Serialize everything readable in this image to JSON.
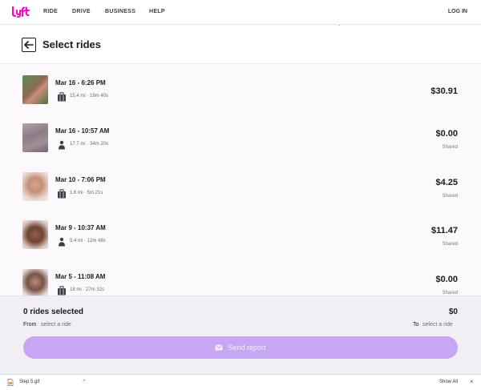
{
  "nav": {
    "logo_icon": "lyft-logo-icon",
    "links": [
      "RIDE",
      "DRIVE",
      "BUSINESS",
      "HELP"
    ],
    "login": "LOG IN"
  },
  "header": {
    "back_icon": "arrow-left-icon",
    "title": "Select rides"
  },
  "rides": [
    {
      "time": "Mar 16 - 6:26 PM",
      "meta": "15.4 mi · 19m 40s",
      "price": "$30.91",
      "note": "",
      "type_icon": "luggage-icon"
    },
    {
      "time": "Mar 16 - 10:57 AM",
      "meta": "17.7 mi · 34m 20s",
      "price": "$0.00",
      "note": "Shared",
      "type_icon": "person-icon"
    },
    {
      "time": "Mar 10 - 7:06 PM",
      "meta": "1.6 mi · 5m 21s",
      "price": "$4.25",
      "note": "Shared",
      "type_icon": "luggage-icon"
    },
    {
      "time": "Mar 9 - 10:37 AM",
      "meta": "5.4 mi · 12m 48s",
      "price": "$11.47",
      "note": "Shared",
      "type_icon": "person-icon"
    },
    {
      "time": "Mar 5 - 11:08 AM",
      "meta": "18 mi · 27m 32s",
      "price": "$0.00",
      "note": "Shared",
      "type_icon": "luggage-icon"
    }
  ],
  "summary": {
    "selected": "0 rides selected",
    "total": "$0",
    "from_label": "From",
    "from_value": "select a ride",
    "to_label": "To",
    "to_value": "select a ride",
    "send_label": "Send report",
    "send_icon": "envelope-icon"
  },
  "download_bar": {
    "file_name": "Step 5.gif",
    "show_all": "Show All"
  },
  "colors": {
    "brand": "#ff00bf",
    "button": "#c7a7f4",
    "footer_bg": "#f1eff4"
  }
}
